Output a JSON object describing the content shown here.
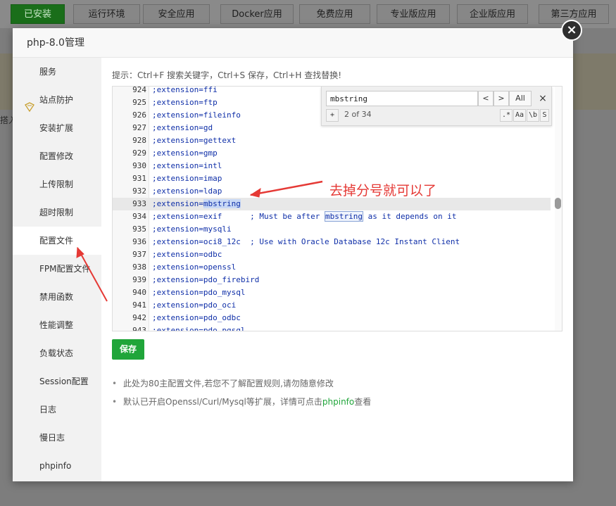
{
  "bg_tabs": [
    "已安装",
    "运行环境",
    "安全应用",
    "Docker应用",
    "免费应用",
    "专业版应用",
    "企业版应用",
    "第三方应用"
  ],
  "bg_left_text": "搭入",
  "modal": {
    "title": "php-8.0管理",
    "close_label": "×"
  },
  "sidebar": {
    "items": [
      "服务",
      "站点防护",
      "安装扩展",
      "配置修改",
      "上传限制",
      "超时限制",
      "配置文件",
      "FPM配置文件",
      "禁用函数",
      "性能调整",
      "负载状态",
      "Session配置",
      "日志",
      "慢日志",
      "phpinfo"
    ],
    "active_index": 6
  },
  "hint": "提示：Ctrl+F 搜索关键字，Ctrl+S 保存，Ctrl+H 查找替换!",
  "editor": {
    "lines": [
      {
        "n": "924",
        "pre": ";extension=ffi",
        "match": "",
        "post": ""
      },
      {
        "n": "925",
        "pre": ";extension=ftp",
        "match": "",
        "post": ""
      },
      {
        "n": "926",
        "pre": ";extension=fileinfo",
        "match": "",
        "post": ""
      },
      {
        "n": "927",
        "pre": ";extension=gd",
        "match": "",
        "post": ""
      },
      {
        "n": "928",
        "pre": ";extension=gettext",
        "match": "",
        "post": ""
      },
      {
        "n": "929",
        "pre": ";extension=gmp",
        "match": "",
        "post": ""
      },
      {
        "n": "930",
        "pre": ";extension=intl",
        "match": "",
        "post": ""
      },
      {
        "n": "931",
        "pre": ";extension=imap",
        "match": "",
        "post": ""
      },
      {
        "n": "932",
        "pre": ";extension=ldap",
        "match": "",
        "post": ""
      },
      {
        "n": "933",
        "pre": ";extension=",
        "match": "mbstring",
        "post": ""
      },
      {
        "n": "934",
        "pre": ";extension=exif      ; Must be after ",
        "match": "mbstring",
        "post": " as it depends on it"
      },
      {
        "n": "935",
        "pre": ";extension=mysqli",
        "match": "",
        "post": ""
      },
      {
        "n": "936",
        "pre": ";extension=oci8_12c  ; Use with Oracle Database 12c Instant Client",
        "match": "",
        "post": ""
      },
      {
        "n": "937",
        "pre": ";extension=odbc",
        "match": "",
        "post": ""
      },
      {
        "n": "938",
        "pre": ";extension=openssl",
        "match": "",
        "post": ""
      },
      {
        "n": "939",
        "pre": ";extension=pdo_firebird",
        "match": "",
        "post": ""
      },
      {
        "n": "940",
        "pre": ";extension=pdo_mysql",
        "match": "",
        "post": ""
      },
      {
        "n": "941",
        "pre": ";extension=pdo_oci",
        "match": "",
        "post": ""
      },
      {
        "n": "942",
        "pre": ";extension=pdo_odbc",
        "match": "",
        "post": ""
      },
      {
        "n": "943",
        "pre": ";extension=pdo_pgsql",
        "match": "",
        "post": ""
      }
    ],
    "highlight_line": "933"
  },
  "search": {
    "value": "mbstring",
    "prev_label": "<",
    "next_label": ">",
    "all_label": "All",
    "close_label": "×",
    "plus_label": "+",
    "counter": "2 of 34",
    "regex_label": ".*",
    "case_label": "Aa",
    "word_label": "\\b",
    "selection_label": "S"
  },
  "save_label": "保存",
  "notes": {
    "note1": "此处为80主配置文件,若您不了解配置规则,请勿随意修改",
    "note2_pre": "默认已开启Openssl/Curl/Mysql等扩展，详情可点击",
    "note2_link": "phpinfo",
    "note2_post": "查看"
  },
  "annotation": "去掉分号就可以了",
  "colors": {
    "accent": "#20a53a",
    "annotation": "#e53935",
    "code": "#0f2fa8"
  }
}
